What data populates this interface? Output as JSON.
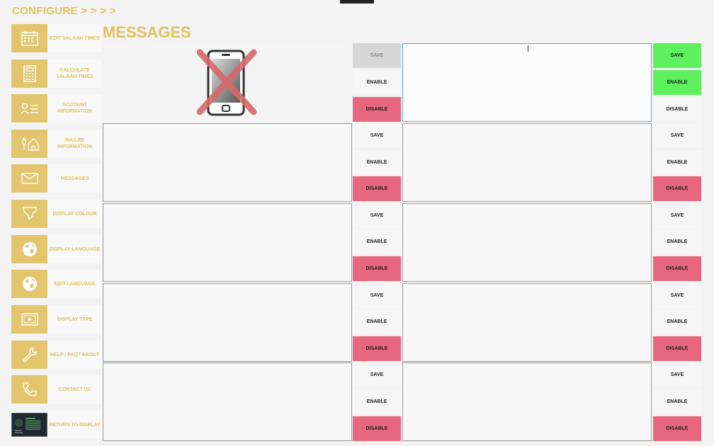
{
  "app": {
    "title": "CONFIGURE > > > >"
  },
  "page": {
    "title": "MESSAGES"
  },
  "sidebar": {
    "items": [
      {
        "label": "EDIT SALAAH TIMES",
        "icon": "calendar-icon"
      },
      {
        "label": "CALCULATE SALAAH TIMES",
        "icon": "calculator-icon"
      },
      {
        "label": "ACCOUNT INFORMATION",
        "icon": "account-card-icon"
      },
      {
        "label": "MASJID INFORMATION",
        "icon": "house-tree-icon"
      },
      {
        "label": "MESSAGES",
        "icon": "envelope-icon"
      },
      {
        "label": "DISPLAY COLOUR",
        "icon": "highlighter-icon"
      },
      {
        "label": "DISPLAY LANGUAGE",
        "icon": "globe-icon"
      },
      {
        "label": "EDIT LANGUAGE",
        "icon": "globe-icon"
      },
      {
        "label": "DISPLAY TYPE",
        "icon": "display-play-icon"
      },
      {
        "label": "HELP / FAQ / ABOUT",
        "icon": "wrench-icon"
      },
      {
        "label": "CONTACT US",
        "icon": "phone-icon"
      },
      {
        "label": "RETURN TO DISPLAY",
        "icon": "display-thumbnail-icon"
      }
    ]
  },
  "buttons": {
    "save": "SAVE",
    "enable": "ENABLE",
    "disable": "DISABLE"
  },
  "colors": {
    "accent": "#e3c15f",
    "icon_bg": "#e3c56e",
    "disable": "#e6677f",
    "active_green": "#5df15d",
    "active_border": "#5aa6d6"
  }
}
